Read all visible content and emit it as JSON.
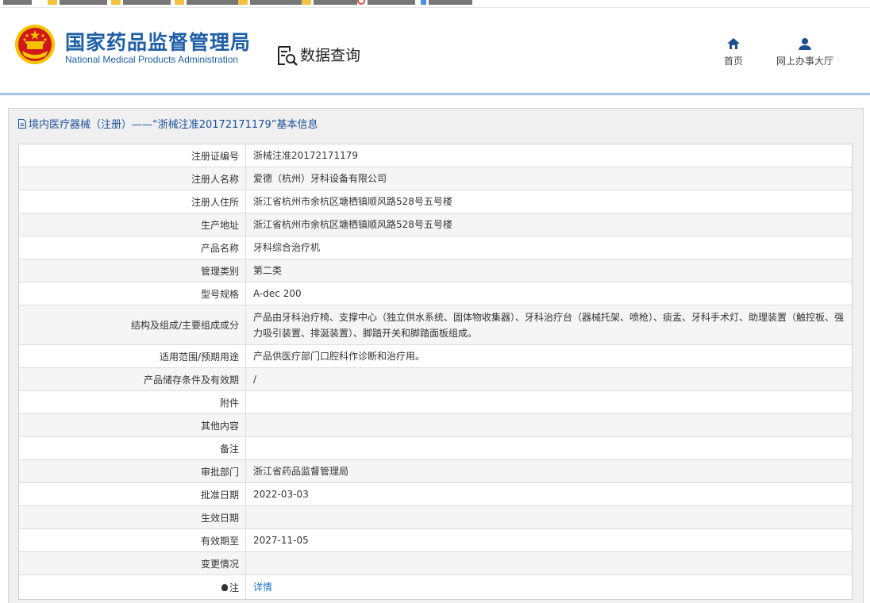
{
  "header": {
    "org_name_cn": "国家药品监督管理局",
    "org_name_en": "National Medical Products Administration",
    "section_title": "数据查询",
    "nav": [
      {
        "label": "首页",
        "icon": "home-icon"
      },
      {
        "label": "网上办事大厅",
        "icon": "user-icon"
      }
    ]
  },
  "panel": {
    "title": "境内医疗器械（注册）——“浙械注准20172171179”基本信息"
  },
  "rows": [
    {
      "label": "注册证编号",
      "value": "浙械注准20172171179"
    },
    {
      "label": "注册人名称",
      "value": "爱德（杭州）牙科设备有限公司"
    },
    {
      "label": "注册人住所",
      "value": "浙江省杭州市余杭区塘栖镇顺风路528号五号楼"
    },
    {
      "label": "生产地址",
      "value": "浙江省杭州市余杭区塘栖镇顺风路528号五号楼"
    },
    {
      "label": "产品名称",
      "value": "牙科综合治疗机"
    },
    {
      "label": "管理类别",
      "value": "第二类"
    },
    {
      "label": "型号规格",
      "value": "A-dec 200"
    },
    {
      "label": "结构及组成/主要组成成分",
      "value": "产品由牙科治疗椅、支撑中心（独立供水系统、固体物收集器）、牙科治疗台（器械托架、喷枪）、痰盂、牙科手术灯、助理装置（触控板、强力吸引装置、排涎装置）、脚踏开关和脚踏面板组成。"
    },
    {
      "label": "适用范围/预期用途",
      "value": "产品供医疗部门口腔科作诊断和治疗用。"
    },
    {
      "label": "产品储存条件及有效期",
      "value": "/"
    },
    {
      "label": "附件",
      "value": ""
    },
    {
      "label": "其他内容",
      "value": ""
    },
    {
      "label": "备注",
      "value": ""
    },
    {
      "label": "审批部门",
      "value": "浙江省药品监督管理局"
    },
    {
      "label": "批准日期",
      "value": "2022-03-03"
    },
    {
      "label": "生效日期",
      "value": ""
    },
    {
      "label": "有效期至",
      "value": "2027-11-05"
    },
    {
      "label": "变更情况",
      "value": ""
    },
    {
      "label": "注",
      "value": "详情"
    }
  ],
  "colors": {
    "brand_blue": "#1f5fa6",
    "link_blue": "#1a6fc9",
    "emblem_red": "#d0171b",
    "emblem_gold": "#f5c400"
  }
}
